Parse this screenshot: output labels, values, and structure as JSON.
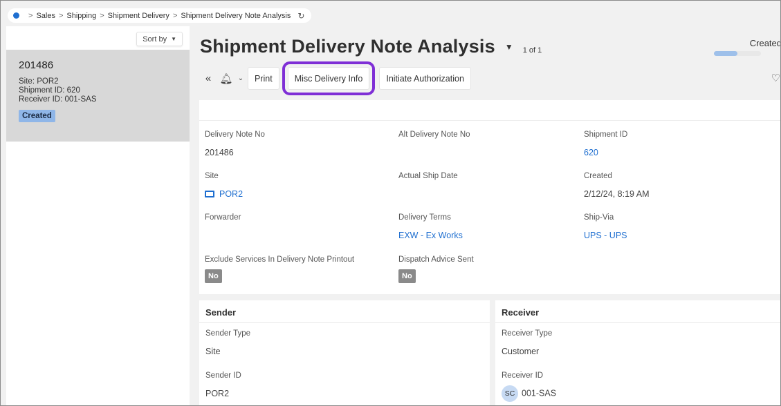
{
  "breadcrumb": {
    "items": [
      "Sales",
      "Shipping",
      "Shipment Delivery",
      "Shipment Delivery Note Analysis"
    ],
    "sep": ">"
  },
  "left": {
    "sort_label": "Sort by",
    "record": {
      "id": "201486",
      "site": "Site:  POR2",
      "shipment": "Shipment ID:  620",
      "receiver": "Receiver ID:  001-SAS",
      "status": "Created"
    }
  },
  "header": {
    "title": "Shipment Delivery Note Analysis",
    "pager": "1 of 1",
    "status": "Created",
    "status_progress": 0.5
  },
  "toolbar": {
    "print": "Print",
    "misc": "Misc Delivery Info",
    "authorize": "Initiate Authorization"
  },
  "fields": {
    "delivery_note_no": {
      "label": "Delivery Note No",
      "value": "201486"
    },
    "alt_delivery_note_no": {
      "label": "Alt Delivery Note No",
      "value": ""
    },
    "shipment_id": {
      "label": "Shipment ID",
      "value": "620"
    },
    "site": {
      "label": "Site",
      "value": "POR2"
    },
    "actual_ship_date": {
      "label": "Actual Ship Date",
      "value": ""
    },
    "created": {
      "label": "Created",
      "value": "2/12/24, 8:19 AM"
    },
    "forwarder": {
      "label": "Forwarder",
      "value": ""
    },
    "delivery_terms": {
      "label": "Delivery Terms",
      "value": "EXW - Ex Works"
    },
    "ship_via": {
      "label": "Ship-Via",
      "value": "UPS - UPS"
    },
    "exclude_services": {
      "label": "Exclude Services In Delivery Note Printout",
      "value": "No"
    },
    "dispatch_advice": {
      "label": "Dispatch Advice Sent",
      "value": "No"
    }
  },
  "sender": {
    "title": "Sender",
    "type_label": "Sender Type",
    "type_value": "Site",
    "id_label": "Sender ID",
    "id_value": "POR2"
  },
  "receiver": {
    "title": "Receiver",
    "type_label": "Receiver Type",
    "type_value": "Customer",
    "id_label": "Receiver ID",
    "avatar": "SC",
    "id_value": "001-SAS"
  },
  "colors": {
    "accent": "#1f6fd0",
    "highlight": "#7f2fd6",
    "badge": "#8fb6e8"
  }
}
